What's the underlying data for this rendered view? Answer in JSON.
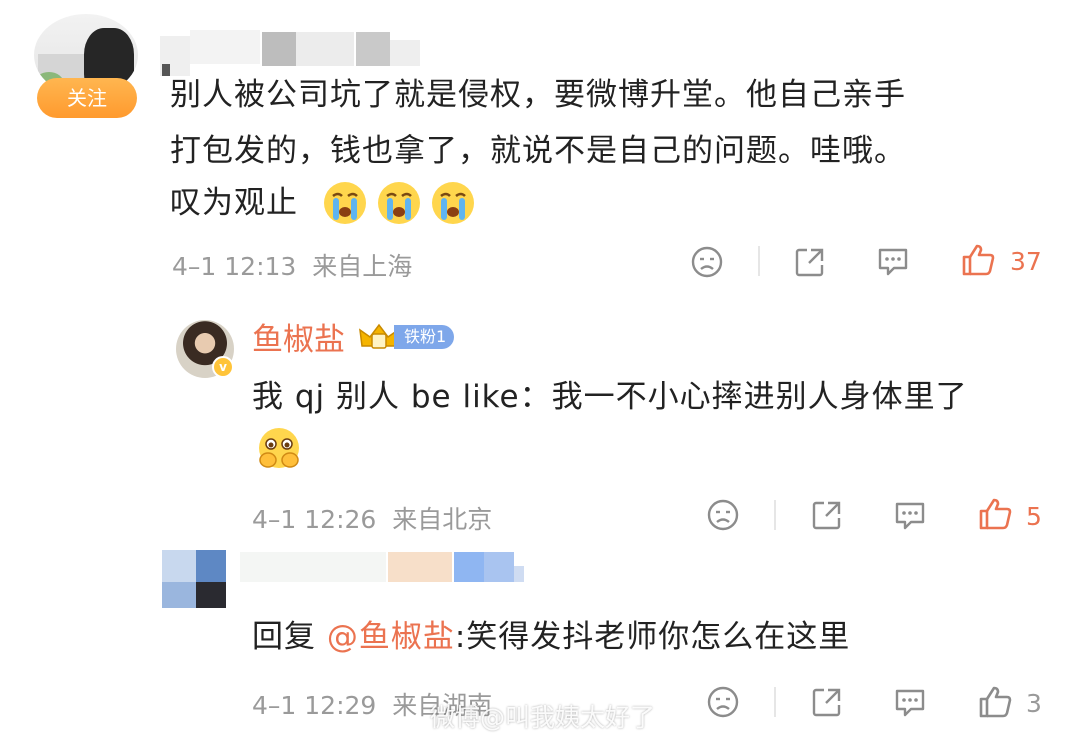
{
  "comment1": {
    "follow_label": "关注",
    "text_line1": "别人被公司坑了就是侵权，要微博升堂。他自己亲手",
    "text_line2": "打包发的，钱也拿了，就说不是自己的问题。哇哦。",
    "text_line3": "叹为观止",
    "emojis": [
      "crying-emoji",
      "crying-emoji",
      "crying-emoji"
    ],
    "timestamp": "4–1 12:13",
    "location": "来自上海",
    "like_count": "37"
  },
  "reply1": {
    "username": "鱼椒盐",
    "fan_badge": "铁粉1",
    "text": "我 qj 别人 be like：我一不小心摔进别人身体里了",
    "emoji": "pleading-emoji",
    "timestamp": "4–1 12:26",
    "location": "来自北京",
    "like_count": "5"
  },
  "reply2": {
    "prefix": "回复 ",
    "mention": "@鱼椒盐",
    "text": ":笑得发抖老师你怎么在这里",
    "timestamp": "4–1 12:29",
    "location": "来自湖南",
    "like_count": "3"
  },
  "watermark": "微博@叫我姨太好了",
  "colors": {
    "accent": "#eb7350",
    "follow_button": "#ff9a2e",
    "meta_text": "#9a9a9a",
    "fan_badge": "#7ea7ea"
  }
}
